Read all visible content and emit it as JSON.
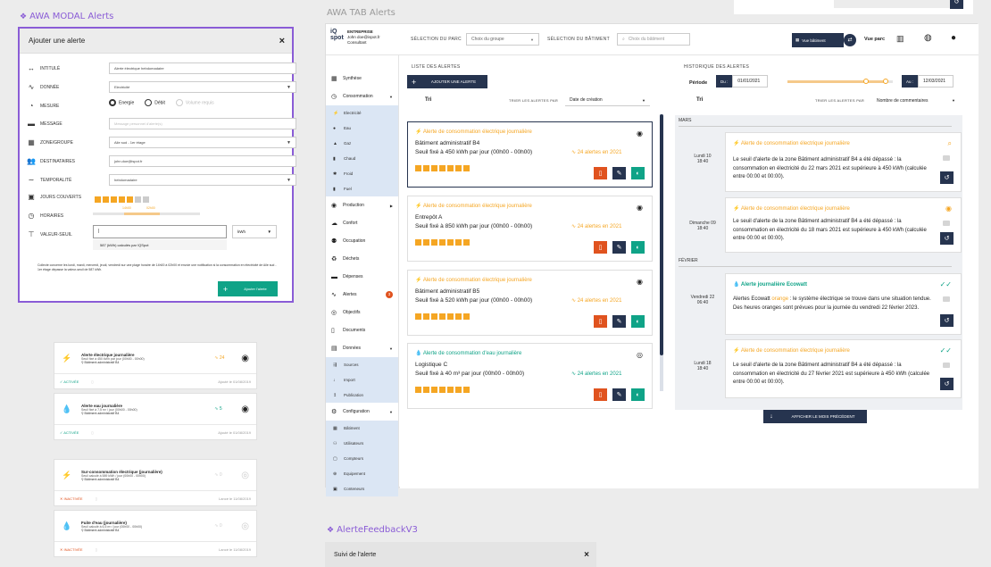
{
  "frames": {
    "modal_title": "AWA MODAL Alerts",
    "tab_title": "AWA TAB Alerts",
    "feedback_title": "AlerteFeedbackV3"
  },
  "modal": {
    "header": "Ajouter une alerte",
    "close": "×",
    "rows": {
      "intitule": {
        "label": "INTITULÉ",
        "value": "Alerte électrique hebdomadaire"
      },
      "donnee": {
        "label": "DONNÉE",
        "value": "Electricité"
      },
      "mesure": {
        "label": "MESURE",
        "options": [
          "Energie",
          "Débit",
          "Volume requis"
        ]
      },
      "message": {
        "label": "MESSAGE",
        "placeholder": "Message personnel d'alerte(s)"
      },
      "zone": {
        "label": "ZONE/GROUPE",
        "value": "Aile sud - 1er étage"
      },
      "destinataires": {
        "label": "DESTINATAIRES",
        "value": "john.doe@ispot.fr"
      },
      "temporalite": {
        "label": "TEMPORALITÉ",
        "value": "hebdomadaire"
      },
      "jours": {
        "label": "JOURS COUVERTS",
        "days": [
          "L",
          "M",
          "M",
          "J",
          "V",
          "S",
          "D"
        ]
      },
      "horaires": {
        "label": "HORAIRES",
        "from": "14h00",
        "to": "02h00"
      },
      "seuil": {
        "label": "VALEUR-SEUIL",
        "value": "|",
        "unit": "kWh",
        "hint": "587 (kWh) calculés par !QSpot"
      }
    },
    "summary": "Collecte concerne les lundi, mardi, mercredi, jeudi, vendredi sur une plage horaire de 14h00 à 02h00 et envoie une notification si la consommation en électricité de Aile sud - 1er étage dépasse la valeur-seuil de 587 kWh.",
    "add_button": "Ajouter l'alerte"
  },
  "small_cards": [
    {
      "title": "Alerte électrique journalière",
      "line1": "Seuil fixé à 450 kWh par jour (00h00 - 00h00)",
      "line2": "Bâtiment administratif B4",
      "count": "24",
      "status": "ACTIVÉE",
      "date": "Ajouté le 01/08/2019",
      "active": true,
      "icon": "bolt-icon"
    },
    {
      "title": "Alerte eau journalière",
      "line1": "Seuil fixé à 7,5 m³ / jour (00h00 - 00h00)",
      "line2": "Bâtiment administratif B4",
      "count": "5",
      "status": "ACTIVÉE",
      "date": "Ajouté le 01/08/2019",
      "active": true,
      "icon": "drop-icon"
    },
    {
      "title": "Sur-consommation électrique (journalière)",
      "line1": "Seuil calculé à 589 kWh / jour (00h00 - 00h00)",
      "line2": "Bâtiment administratif B4",
      "count": "0",
      "status": "INACTIVÉE",
      "date": "Lancé le 11/08/2019",
      "active": false,
      "icon": "bolt-icon"
    },
    {
      "title": "Fuite d'eau (journalière)",
      "line1": "Seuil calculé à 6,5 m³ / jour (00h00 - 00h00)",
      "line2": "Bâtiment administratif B4",
      "count": "0",
      "status": "INACTIVÉE",
      "date": "Lancé le 11/08/2019",
      "active": false,
      "icon": "drop-icon"
    }
  ],
  "topbar": {
    "logo": "iQ spot",
    "company": "ENTREPRISE",
    "user": "John doe@ispot.fr",
    "role": "Consultant",
    "parc_label": "SÉLECTION DU PARC",
    "parc_value": "Choix du groupe",
    "bat_label": "SÉLECTION DU BÂTIMENT",
    "bat_placeholder": "Choix du bâtiment",
    "vue_batiment": "Vue bâtiment",
    "vue_parc": "Vue parc"
  },
  "sidebar": {
    "synthese": "Synthèse",
    "consommation": "Consommation",
    "conso_items": [
      "Electricité",
      "Eau",
      "Gaz",
      "Chaud",
      "Froid",
      "Fuel"
    ],
    "production": "Production",
    "confort": "Confort",
    "occupation": "Occupation",
    "dechets": "Déchets",
    "depenses": "Dépenses",
    "alertes": "Alertes",
    "alertes_badge": "3",
    "objectifs": "Objectifs",
    "documents": "Documents",
    "donnees": "Données",
    "donnees_items": [
      "Sources",
      "Import",
      "Publication"
    ],
    "configuration": "Configuration",
    "config_items": [
      "Bâtiment",
      "Utilisateurs",
      "Compteurs",
      "Equipement",
      "Conteneurs"
    ]
  },
  "list": {
    "title": "LISTE DES ALERTES",
    "add_button": "AJOUTER UNE ALERTE",
    "tri": "Tri",
    "sort_label": "TRIER LES ALERTES PAR",
    "sort_value": "Date de création",
    "cards": [
      {
        "title": "Alerte de consommation électrique journalière",
        "building": "Bâtiment administratif B4",
        "threshold": "Seuil fixé à 450 kWh par jour (00h00 - 00h00)",
        "count": "24 alertes en 2021",
        "selected": true,
        "water": false
      },
      {
        "title": "Alerte de consommation électrique journalière",
        "building": "Entrepôt A",
        "threshold": "Seuil fixé à 850 kWh par jour (00h00 - 00h00)",
        "count": "24 alertes en 2021",
        "selected": false,
        "water": false
      },
      {
        "title": "Alerte de consommation électrique journalière",
        "building": "Bâtiment administratif B5",
        "threshold": "Seuil fixé à 520 kWh par jour (00h00 - 00h00)",
        "count": "24 alertes en 2021",
        "selected": false,
        "water": false
      },
      {
        "title": "Alerte de consommation d'eau journalière",
        "building": "Logistique C",
        "threshold": "Seuil fixé à 40 m³ par jour (00h00 - 00h00)",
        "count": "24 alertes en 2021",
        "selected": false,
        "water": true
      }
    ]
  },
  "history": {
    "title": "HISTORIQUE DES ALERTES",
    "periode": "Période",
    "du": "Du :",
    "from": "01/01/2021",
    "au": "Au :",
    "to": "12/03/2021",
    "tri": "Tri",
    "sort_label": "TRIER LES ALERTES PAR",
    "sort_value": "Nombre de commentaires",
    "month_mars": "MARS",
    "month_fevrier": "FÉVRIER",
    "entries": [
      {
        "date": "Lundi 10",
        "time": "18:40",
        "title": "Alerte de consommation électrique journalière",
        "body": "Le seuil d'alerte de la zone Bâtiment administratif B4 a été dépassé : la consommation en électricité du 22 mars 2021 est supérieure à 450 kWh (calculée entre 00:00 et 00:00).",
        "teal": false
      },
      {
        "date": "Dimanche 09",
        "time": "18:40",
        "title": "Alerte de consommation électrique journalière",
        "body": "Le seuil d'alerte de la zone Bâtiment administratif B4 a été dépassé : la consommation en électricité du 18 mars 2021 est supérieure à 450 kWh (calculée entre 00:00 et 00:00).",
        "teal": false
      },
      {
        "date": "Vendredi 22",
        "time": "06:40",
        "title": "Alerte journalière Ecowatt",
        "body_pre": "Alertes Ecowatt ",
        "body_hl": "orange",
        "body_post": " : le système électrique se trouve dans une situation tendue. Des heures oranges sont prévues pour la journée du vendredi 22 février 2023.",
        "teal": true
      },
      {
        "date": "Lundi 18",
        "time": "18:40",
        "title": "Alerte de consommation électrique journalière",
        "body": "Le seuil d'alerte de la zone Bâtiment administratif B4 a été dépassé : la consommation en électricité du 27 février 2021 est supérieure à 450 kWh (calculée entre 00:00 et 00:00).",
        "teal": false
      }
    ],
    "show_prev": "AFFICHER LE MOIS PRÉCÉDENT"
  },
  "feedback": {
    "header": "Suivi de l'alerte",
    "close": "×"
  },
  "colors": {
    "accent": "#8a5cd6",
    "navy": "#26344f",
    "orange": "#f5a623",
    "teal": "#0fa387",
    "red": "#e0531f"
  }
}
